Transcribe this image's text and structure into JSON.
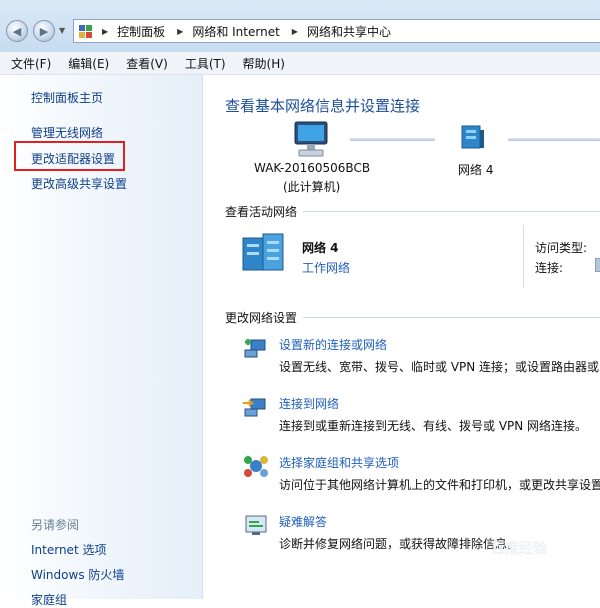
{
  "address": {
    "segments": [
      "控制面板",
      "网络和 Internet",
      "网络和共享中心"
    ]
  },
  "menu": [
    "文件(F)",
    "编辑(E)",
    "查看(V)",
    "工具(T)",
    "帮助(H)"
  ],
  "sidebar": {
    "items": [
      "控制面板主页",
      "管理无线网络",
      "更改适配器设置",
      "更改高级共享设置"
    ],
    "see_also_title": "另请参阅",
    "see_also": [
      "Internet 选项",
      "Windows 防火墙",
      "家庭组"
    ]
  },
  "main": {
    "title": "查看基本网络信息并设置连接",
    "computer_name": "WAK-20160506BCB",
    "computer_sub": "(此计算机)",
    "network_map_name": "网络 4",
    "active_section": "查看活动网络",
    "active_network": {
      "name": "网络  4",
      "type": "工作网络",
      "access_type_label": "访问类型:",
      "connection_label": "连接:"
    },
    "change_section": "更改网络设置",
    "tasks": [
      {
        "link": "设置新的连接或网络",
        "desc": "设置无线、宽带、拨号、临时或 VPN 连接；或设置路由器或"
      },
      {
        "link": "连接到网络",
        "desc": "连接到或重新连接到无线、有线、拨号或 VPN 网络连接。"
      },
      {
        "link": "选择家庭组和共享选项",
        "desc": "访问位于其他网络计算机上的文件和打印机，或更改共享设置"
      },
      {
        "link": "疑难解答",
        "desc": "诊断并修复网络问题，或获得故障排除信息。"
      }
    ],
    "watermark": "百度经验"
  },
  "colors": {
    "link": "#1f5fbd",
    "title": "#1d4f9c",
    "sidebar_link": "#0f3e8a",
    "highlight_box": "#e02020"
  }
}
